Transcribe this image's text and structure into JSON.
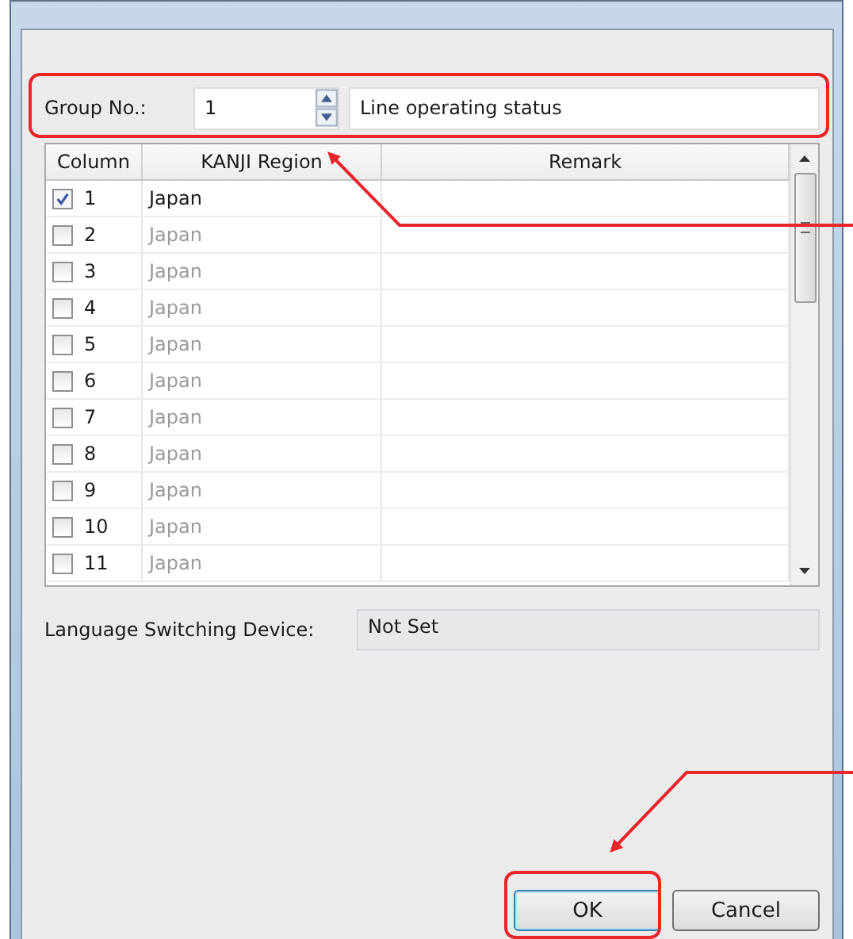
{
  "group": {
    "label": "Group No.:",
    "number": "1",
    "name": "Line operating status"
  },
  "table": {
    "columns": [
      "Column",
      "KANJI Region",
      "Remark"
    ],
    "rows": [
      {
        "column": "1",
        "region": "Japan",
        "checked": true
      },
      {
        "column": "2",
        "region": "Japan",
        "checked": false
      },
      {
        "column": "3",
        "region": "Japan",
        "checked": false
      },
      {
        "column": "4",
        "region": "Japan",
        "checked": false
      },
      {
        "column": "5",
        "region": "Japan",
        "checked": false
      },
      {
        "column": "6",
        "region": "Japan",
        "checked": false
      },
      {
        "column": "7",
        "region": "Japan",
        "checked": false
      },
      {
        "column": "8",
        "region": "Japan",
        "checked": false
      },
      {
        "column": "9",
        "region": "Japan",
        "checked": false
      },
      {
        "column": "10",
        "region": "Japan",
        "checked": false
      },
      {
        "column": "11",
        "region": "Japan",
        "checked": false
      }
    ]
  },
  "language_switching": {
    "label": "Language Switching Device:",
    "value": "Not Set"
  },
  "buttons": [
    "OK",
    "Cancel"
  ]
}
